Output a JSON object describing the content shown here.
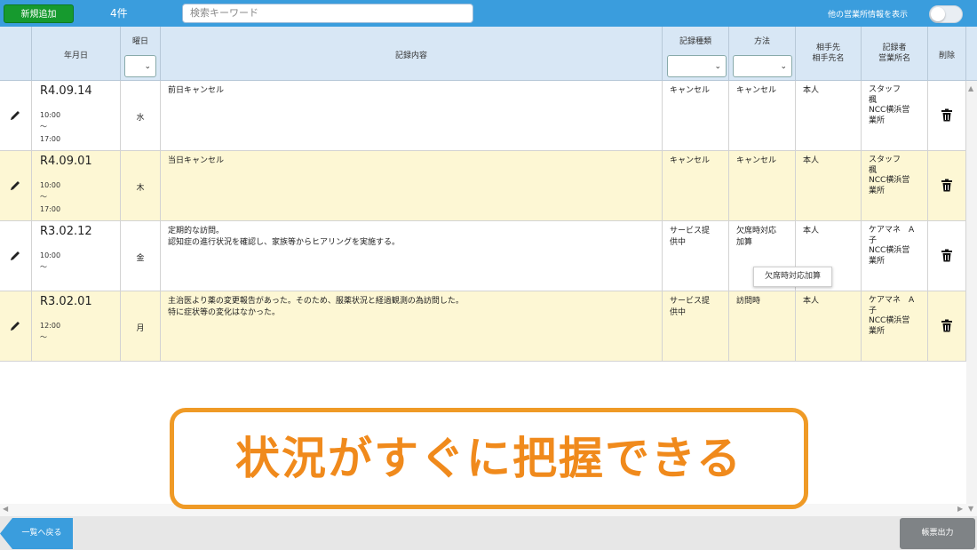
{
  "toolbar": {
    "new_button": "新規追加",
    "count": "4件",
    "search_placeholder": "検索キーワード",
    "toggle_label": "他の営業所情報を表示"
  },
  "table": {
    "headers": {
      "date": "年月日",
      "weekday": "曜日",
      "content": "記録内容",
      "record_type": "記録種類",
      "method": "方法",
      "counterpart": "相手先\n相手先名",
      "recorder": "記録者\n営業所名",
      "delete": "削除"
    },
    "rows": [
      {
        "date": "R4.09.14",
        "time_start": "10:00",
        "tilde": "～",
        "time_end": "17:00",
        "weekday": "水",
        "content": "前日キャンセル",
        "record_type": "キャンセル",
        "method": "キャンセル",
        "counterpart": "本人",
        "recorder": "スタッフ\n楓\nNCC横浜営\n業所"
      },
      {
        "date": "R4.09.01",
        "time_start": "10:00",
        "tilde": "～",
        "time_end": "17:00",
        "weekday": "木",
        "content": "当日キャンセル",
        "record_type": "キャンセル",
        "method": "キャンセル",
        "counterpart": "本人",
        "recorder": "スタッフ\n楓\nNCC横浜営\n業所"
      },
      {
        "date": "R3.02.12",
        "time_start": "10:00",
        "tilde": "～",
        "time_end": "",
        "weekday": "金",
        "content": "定期的な訪問。\n認知症の進行状況を確認し、家族等からヒアリングを実施する。",
        "record_type": "サービス提\n供中",
        "method": "欠席時対応\n加算",
        "counterpart": "本人",
        "recorder": "ケアマネ　A\n子\nNCC横浜営\n業所"
      },
      {
        "date": "R3.02.01",
        "time_start": "12:00",
        "tilde": "～",
        "time_end": "",
        "weekday": "月",
        "content": "主治医より薬の変更報告があった。そのため、服薬状況と経過観測の為訪問した。\n特に症状等の変化はなかった。",
        "record_type": "サービス提\n供中",
        "method": "訪問時",
        "counterpart": "本人",
        "recorder": "ケアマネ　A\n子\nNCC横浜営\n業所"
      }
    ]
  },
  "tooltip": "欠席時対応加算",
  "banner": "状況がすぐに把握できる",
  "footer": {
    "back_button": "一覧へ戻る",
    "print_button": "帳票出力"
  },
  "colors": {
    "topbar": "#3a9ddd",
    "new_button": "#169a2e",
    "header": "#d8e7f5",
    "alt_row": "#fdf7d4",
    "banner": "#f08a1c"
  }
}
